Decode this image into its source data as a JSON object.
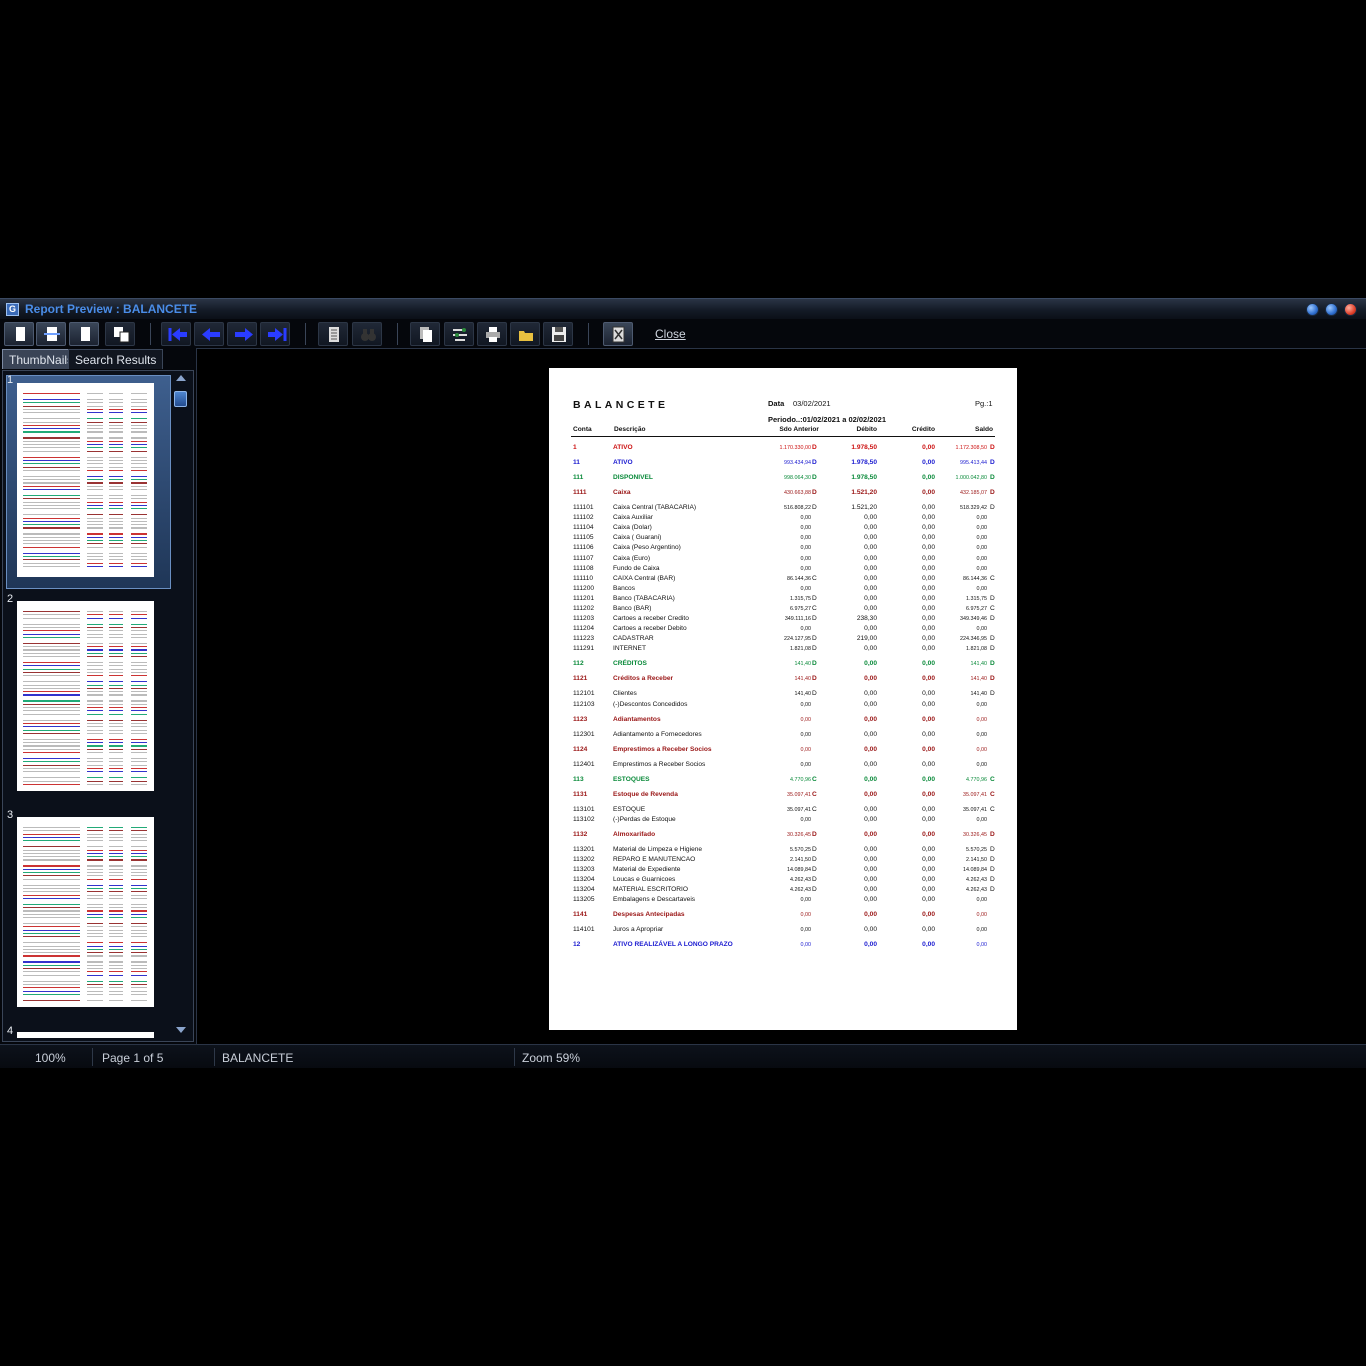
{
  "window": {
    "title": "Report Preview : BALANCETE"
  },
  "toolbar": {
    "close_label": "Close"
  },
  "tabs": {
    "thumbnails": "ThumbNails",
    "search": "Search Results"
  },
  "thumbnails": {
    "page_numbers": [
      "1",
      "2",
      "3",
      "4"
    ]
  },
  "status": {
    "zoom_pct": "100%",
    "page": "Page 1 of 5",
    "report_name": "BALANCETE",
    "zoom": "Zoom 59%"
  },
  "report": {
    "title": "BALANCETE",
    "date_label": "Data",
    "date": "03/02/2021",
    "page_label": "Pg.:1",
    "period": "Periodo..:01/02/2021 a 02/02/2021",
    "columns": {
      "conta": "Conta",
      "descricao": "Descrição",
      "sdo_anterior": "Sdo Anterior",
      "debito": "Débito",
      "credito": "Crédito",
      "saldo": "Saldo"
    },
    "colors": {
      "red": "#cc1111",
      "blue": "#1a1ad0",
      "green": "#0a8a3a",
      "darkred": "#9a1616",
      "black": "#111111"
    },
    "rows": [
      {
        "conta": "1",
        "desc": "ATIVO",
        "ant": "1.170.330,00",
        "af": "D",
        "deb": "1.978,50",
        "cre": "0,00",
        "sal": "1.172.308,50",
        "sf": "D",
        "color": "red",
        "bold": true
      },
      {
        "conta": "11",
        "desc": "ATIVO",
        "ant": "993.434,94",
        "af": "D",
        "deb": "1.978,50",
        "cre": "0,00",
        "sal": "995.413,44",
        "sf": "D",
        "color": "blue",
        "bold": true
      },
      {
        "conta": "111",
        "desc": "DISPONIVEL",
        "ant": "998.064,30",
        "af": "D",
        "deb": "1.978,50",
        "cre": "0,00",
        "sal": "1.000.042,80",
        "sf": "D",
        "color": "green",
        "bold": true
      },
      {
        "conta": "1111",
        "desc": "Caixa",
        "ant": "430.663,88",
        "af": "D",
        "deb": "1.521,20",
        "cre": "0,00",
        "sal": "432.185,07",
        "sf": "D",
        "color": "darkred",
        "bold": true
      },
      {
        "conta": "111101",
        "desc": "Caixa Central (TABACARIA)",
        "ant": "516.808,22",
        "af": "D",
        "deb": "1.521,20",
        "cre": "0,00",
        "sal": "518.329,42",
        "sf": "D",
        "color": "black"
      },
      {
        "conta": "111102",
        "desc": "Caixa Auxiliar",
        "ant": "0,00",
        "af": "",
        "deb": "0,00",
        "cre": "0,00",
        "sal": "0,00",
        "sf": "",
        "color": "black"
      },
      {
        "conta": "111104",
        "desc": "Caixa (Dolar)",
        "ant": "0,00",
        "af": "",
        "deb": "0,00",
        "cre": "0,00",
        "sal": "0,00",
        "sf": "",
        "color": "black"
      },
      {
        "conta": "111105",
        "desc": "Caixa ( Guarani)",
        "ant": "0,00",
        "af": "",
        "deb": "0,00",
        "cre": "0,00",
        "sal": "0,00",
        "sf": "",
        "color": "black"
      },
      {
        "conta": "111106",
        "desc": "Caixa (Peso Argentino)",
        "ant": "0,00",
        "af": "",
        "deb": "0,00",
        "cre": "0,00",
        "sal": "0,00",
        "sf": "",
        "color": "black"
      },
      {
        "conta": "111107",
        "desc": "Caixa (Euro)",
        "ant": "0,00",
        "af": "",
        "deb": "0,00",
        "cre": "0,00",
        "sal": "0,00",
        "sf": "",
        "color": "black"
      },
      {
        "conta": "111108",
        "desc": "Fundo de Caixa",
        "ant": "0,00",
        "af": "",
        "deb": "0,00",
        "cre": "0,00",
        "sal": "0,00",
        "sf": "",
        "color": "black"
      },
      {
        "conta": "111110",
        "desc": "CAIXA Central (BAR)",
        "ant": "86.144,36",
        "af": "C",
        "deb": "0,00",
        "cre": "0,00",
        "sal": "86.144,36",
        "sf": "C",
        "color": "black"
      },
      {
        "conta": "111200",
        "desc": "Bancos",
        "ant": "0,00",
        "af": "",
        "deb": "0,00",
        "cre": "0,00",
        "sal": "0,00",
        "sf": "",
        "color": "black"
      },
      {
        "conta": "111201",
        "desc": "Banco (TABACARIA)",
        "ant": "1.315,75",
        "af": "D",
        "deb": "0,00",
        "cre": "0,00",
        "sal": "1.315,75",
        "sf": "D",
        "color": "black"
      },
      {
        "conta": "111202",
        "desc": "Banco (BAR)",
        "ant": "6.975,27",
        "af": "C",
        "deb": "0,00",
        "cre": "0,00",
        "sal": "6.975,27",
        "sf": "C",
        "color": "black"
      },
      {
        "conta": "111203",
        "desc": "Cartoes a receber Credito",
        "ant": "349.111,16",
        "af": "D",
        "deb": "238,30",
        "cre": "0,00",
        "sal": "349.349,46",
        "sf": "D",
        "color": "black"
      },
      {
        "conta": "111204",
        "desc": "Cartoes a receber Debito",
        "ant": "0,00",
        "af": "",
        "deb": "0,00",
        "cre": "0,00",
        "sal": "0,00",
        "sf": "",
        "color": "black"
      },
      {
        "conta": "111223",
        "desc": "CADASTRAR",
        "ant": "224.127,95",
        "af": "D",
        "deb": "219,00",
        "cre": "0,00",
        "sal": "224.346,95",
        "sf": "D",
        "color": "black"
      },
      {
        "conta": "111291",
        "desc": "INTERNET",
        "ant": "1.821,08",
        "af": "D",
        "deb": "0,00",
        "cre": "0,00",
        "sal": "1.821,08",
        "sf": "D",
        "color": "black"
      },
      {
        "conta": "112",
        "desc": "CRÉDITOS",
        "ant": "141,40",
        "af": "D",
        "deb": "0,00",
        "cre": "0,00",
        "sal": "141,40",
        "sf": "D",
        "color": "green",
        "bold": true
      },
      {
        "conta": "1121",
        "desc": "Créditos a Receber",
        "ant": "141,40",
        "af": "D",
        "deb": "0,00",
        "cre": "0,00",
        "sal": "141,40",
        "sf": "D",
        "color": "darkred",
        "bold": true
      },
      {
        "conta": "112101",
        "desc": "Clientes",
        "ant": "141,40",
        "af": "D",
        "deb": "0,00",
        "cre": "0,00",
        "sal": "141,40",
        "sf": "D",
        "color": "black"
      },
      {
        "conta": "112103",
        "desc": "(-)Descontos Concedidos",
        "ant": "0,00",
        "af": "",
        "deb": "0,00",
        "cre": "0,00",
        "sal": "0,00",
        "sf": "",
        "color": "black"
      },
      {
        "conta": "1123",
        "desc": "Adiantamentos",
        "ant": "0,00",
        "af": "",
        "deb": "0,00",
        "cre": "0,00",
        "sal": "0,00",
        "sf": "",
        "color": "darkred",
        "bold": true
      },
      {
        "conta": "112301",
        "desc": "Adiantamento a Fornecedores",
        "ant": "0,00",
        "af": "",
        "deb": "0,00",
        "cre": "0,00",
        "sal": "0,00",
        "sf": "",
        "color": "black"
      },
      {
        "conta": "1124",
        "desc": "Emprestimos a Receber Socios",
        "ant": "0,00",
        "af": "",
        "deb": "0,00",
        "cre": "0,00",
        "sal": "0,00",
        "sf": "",
        "color": "darkred",
        "bold": true
      },
      {
        "conta": "112401",
        "desc": "Emprestimos a Receber Socios",
        "ant": "0,00",
        "af": "",
        "deb": "0,00",
        "cre": "0,00",
        "sal": "0,00",
        "sf": "",
        "color": "black"
      },
      {
        "conta": "113",
        "desc": "ESTOQUES",
        "ant": "4.770,96",
        "af": "C",
        "deb": "0,00",
        "cre": "0,00",
        "sal": "4.770,96",
        "sf": "C",
        "color": "green",
        "bold": true
      },
      {
        "conta": "1131",
        "desc": "Estoque de Revenda",
        "ant": "35.097,41",
        "af": "C",
        "deb": "0,00",
        "cre": "0,00",
        "sal": "35.097,41",
        "sf": "C",
        "color": "darkred",
        "bold": true
      },
      {
        "conta": "113101",
        "desc": "ESTOQUE",
        "ant": "35.097,41",
        "af": "C",
        "deb": "0,00",
        "cre": "0,00",
        "sal": "35.097,41",
        "sf": "C",
        "color": "black"
      },
      {
        "conta": "113102",
        "desc": "(-)Perdas de Estoque",
        "ant": "0,00",
        "af": "",
        "deb": "0,00",
        "cre": "0,00",
        "sal": "0,00",
        "sf": "",
        "color": "black"
      },
      {
        "conta": "1132",
        "desc": "Almoxarifado",
        "ant": "30.326,45",
        "af": "D",
        "deb": "0,00",
        "cre": "0,00",
        "sal": "30.326,45",
        "sf": "D",
        "color": "darkred",
        "bold": true
      },
      {
        "conta": "113201",
        "desc": "Material de Limpeza e Higiene",
        "ant": "5.570,25",
        "af": "D",
        "deb": "0,00",
        "cre": "0,00",
        "sal": "5.570,25",
        "sf": "D",
        "color": "black"
      },
      {
        "conta": "113202",
        "desc": "REPARO E MANUTENCAO",
        "ant": "2.141,50",
        "af": "D",
        "deb": "0,00",
        "cre": "0,00",
        "sal": "2.141,50",
        "sf": "D",
        "color": "black"
      },
      {
        "conta": "113203",
        "desc": "Material de Expediente",
        "ant": "14.089,84",
        "af": "D",
        "deb": "0,00",
        "cre": "0,00",
        "sal": "14.089,84",
        "sf": "D",
        "color": "black"
      },
      {
        "conta": "113204",
        "desc": "Loucas e Guarnicoes",
        "ant": "4.262,43",
        "af": "D",
        "deb": "0,00",
        "cre": "0,00",
        "sal": "4.262,43",
        "sf": "D",
        "color": "black"
      },
      {
        "conta": "113204",
        "desc": "MATERIAL ESCRITORIO",
        "ant": "4.262,43",
        "af": "D",
        "deb": "0,00",
        "cre": "0,00",
        "sal": "4.262,43",
        "sf": "D",
        "color": "black"
      },
      {
        "conta": "113205",
        "desc": "Embalagens e Descartaveis",
        "ant": "0,00",
        "af": "",
        "deb": "0,00",
        "cre": "0,00",
        "sal": "0,00",
        "sf": "",
        "color": "black"
      },
      {
        "conta": "1141",
        "desc": "Despesas Antecipadas",
        "ant": "0,00",
        "af": "",
        "deb": "0,00",
        "cre": "0,00",
        "sal": "0,00",
        "sf": "",
        "color": "darkred",
        "bold": true
      },
      {
        "conta": "114101",
        "desc": "Juros a Apropriar",
        "ant": "0,00",
        "af": "",
        "deb": "0,00",
        "cre": "0,00",
        "sal": "0,00",
        "sf": "",
        "color": "black"
      },
      {
        "conta": "12",
        "desc": "ATIVO REALIZÁVEL A LONGO PRAZO",
        "ant": "0,00",
        "af": "",
        "deb": "0,00",
        "cre": "0,00",
        "sal": "0,00",
        "sf": "",
        "color": "blue",
        "bold": true
      }
    ]
  }
}
